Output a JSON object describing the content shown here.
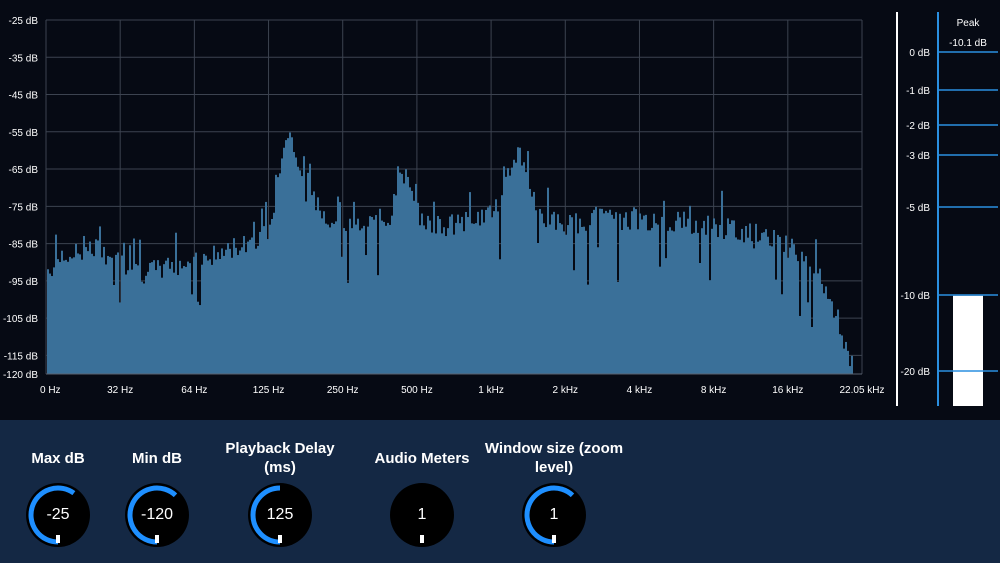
{
  "spectrum": {
    "y_ticks": [
      {
        "label": "-25 dB",
        "value": -25
      },
      {
        "label": "-35 dB",
        "value": -35
      },
      {
        "label": "-45 dB",
        "value": -45
      },
      {
        "label": "-55 dB",
        "value": -55
      },
      {
        "label": "-65 dB",
        "value": -65
      },
      {
        "label": "-75 dB",
        "value": -75
      },
      {
        "label": "-85 dB",
        "value": -85
      },
      {
        "label": "-95 dB",
        "value": -95
      },
      {
        "label": "-105 dB",
        "value": -105
      },
      {
        "label": "-115 dB",
        "value": -115
      },
      {
        "label": "-120 dB",
        "value": -120
      }
    ],
    "x_ticks": [
      "0 Hz",
      "32 Hz",
      "64 Hz",
      "125 Hz",
      "250 Hz",
      "500 Hz",
      "1 kHz",
      "2 kHz",
      "4 kHz",
      "8 kHz",
      "16 kHz",
      "22.05 kHz"
    ],
    "bar_color": "#3a7099",
    "grid_color": "#3c4350",
    "profile_db": [
      [
        0,
        -92
      ],
      [
        3,
        -88
      ],
      [
        6,
        -86
      ],
      [
        9,
        -90
      ],
      [
        12,
        -93
      ],
      [
        15,
        -91
      ],
      [
        18,
        -90
      ],
      [
        21,
        -88
      ],
      [
        24,
        -85
      ],
      [
        27,
        -82
      ],
      [
        28,
        -72
      ],
      [
        29,
        -57
      ],
      [
        30,
        -56
      ],
      [
        31,
        -67
      ],
      [
        32,
        -72
      ],
      [
        34,
        -77
      ],
      [
        36,
        -79
      ],
      [
        38,
        -80
      ],
      [
        40,
        -79
      ],
      [
        42,
        -78
      ],
      [
        43,
        -67
      ],
      [
        44,
        -66
      ],
      [
        45,
        -76
      ],
      [
        47,
        -80
      ],
      [
        50,
        -80
      ],
      [
        53,
        -78
      ],
      [
        55,
        -76
      ],
      [
        56,
        -67
      ],
      [
        57,
        -63
      ],
      [
        58,
        -62
      ],
      [
        59,
        -71
      ],
      [
        61,
        -78
      ],
      [
        64,
        -80
      ],
      [
        67,
        -78
      ],
      [
        70,
        -79
      ],
      [
        72,
        -78
      ],
      [
        75,
        -80
      ],
      [
        77,
        -79
      ],
      [
        80,
        -80
      ],
      [
        83,
        -81
      ],
      [
        86,
        -82
      ],
      [
        89,
        -84
      ],
      [
        92,
        -87
      ],
      [
        94,
        -92
      ],
      [
        96,
        -100
      ],
      [
        97,
        -106
      ],
      [
        98,
        -113
      ],
      [
        99,
        -120
      ]
    ]
  },
  "meter": {
    "title": "Peak",
    "peak_value": "-10.1 dB",
    "level_db": -10.1,
    "ticks": [
      "0 dB",
      "-1 dB",
      "-2 dB",
      "-3 dB",
      "-5 dB",
      "-10 dB",
      "-20 dB"
    ],
    "accent": "#2a8fe0"
  },
  "controls": [
    {
      "label": "Max dB",
      "value": "-25",
      "fill_fraction": 0.6
    },
    {
      "label": "Min dB",
      "value": "-120",
      "fill_fraction": 0.62
    },
    {
      "label": "Playback Delay (ms)",
      "value": "125",
      "fill_fraction": 0.5
    },
    {
      "label": "Audio Meters",
      "value": "1",
      "fill_fraction": 0.0
    },
    {
      "label": "Window size (zoom level)",
      "value": "1",
      "fill_fraction": 0.62
    }
  ],
  "knob_color": "#1e8fff"
}
